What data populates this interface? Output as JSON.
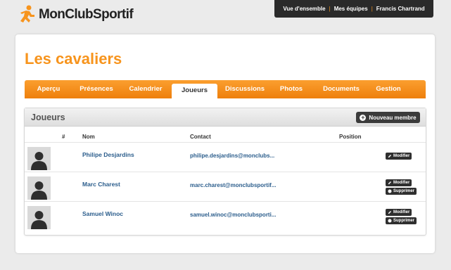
{
  "brand": {
    "name": "MonClubSportif",
    "color": "#f7941d"
  },
  "topnav": [
    "Vue d'ensemble",
    "Mes équipes",
    "Francis Chartrand"
  ],
  "page": {
    "title": "Les cavaliers"
  },
  "tabs": [
    "Aperçu",
    "Présences",
    "Calendrier",
    "Joueurs",
    "Discussions",
    "Photos",
    "Documents",
    "Gestion"
  ],
  "active_tab": "Joueurs",
  "players_section": {
    "title": "Joueurs",
    "new_button": "Nouveau membre",
    "columns": {
      "number": "#",
      "name": "Nom",
      "contact": "Contact",
      "position": "Position"
    },
    "rows": [
      {
        "name": "Philipe Desjardins",
        "contact": "philipe.desjardins@monclubs...",
        "actions": [
          "Modifier"
        ]
      },
      {
        "name": "Marc Charest",
        "contact": "marc.charest@monclubsportif...",
        "actions": [
          "Modifier",
          "Supprimer"
        ]
      },
      {
        "name": "Samuel Winoc",
        "contact": "samuel.winoc@monclubsporti...",
        "actions": [
          "Modifier",
          "Supprimer"
        ]
      }
    ]
  },
  "icons": [
    "runner-logo-icon",
    "plus-icon",
    "pencil-icon",
    "trash-icon",
    "avatar-placeholder-icon"
  ]
}
